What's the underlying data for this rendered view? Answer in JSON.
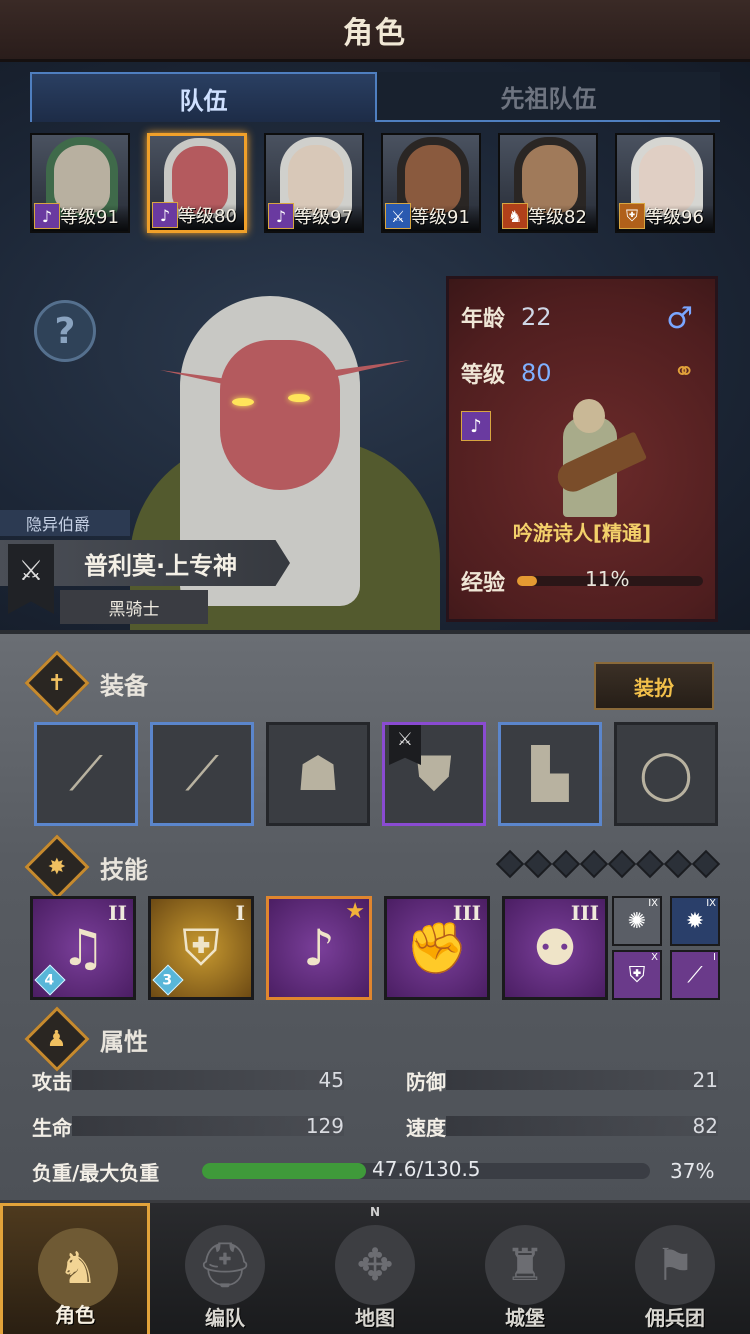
{
  "header": {
    "title": "角色"
  },
  "tabs": [
    {
      "label": "队伍",
      "active": true
    },
    {
      "label": "先祖队伍",
      "active": false
    }
  ],
  "roster": [
    {
      "level": "等级91",
      "skin": "#b8b0a0",
      "hair": "#3f6a4a",
      "class_icon": "lute-icon",
      "class_color": "#6a3aa0",
      "selected": false
    },
    {
      "level": "等级80",
      "skin": "#b45a5e",
      "hair": "#c8c8c4",
      "class_icon": "lute-icon",
      "class_color": "#6a3aa0",
      "selected": true
    },
    {
      "level": "等级97",
      "skin": "#d8c8b8",
      "hair": "#d0d0cc",
      "class_icon": "lute-icon",
      "class_color": "#6a3aa0",
      "selected": false
    },
    {
      "level": "等级91",
      "skin": "#8a5a3e",
      "hair": "#2a2624",
      "class_icon": "sword-icon",
      "class_color": "#2a5ab0",
      "selected": false
    },
    {
      "level": "等级82",
      "skin": "#a07a5a",
      "hair": "#2a2624",
      "class_icon": "horse-icon",
      "class_color": "#b0401a",
      "selected": false
    },
    {
      "level": "等级96",
      "skin": "#e0cfc4",
      "hair": "#d6d6d2",
      "class_icon": "shield-icon",
      "class_color": "#b0601a",
      "selected": false
    }
  ],
  "character": {
    "title": "隐异伯爵",
    "name": "普利莫·上专神",
    "class": "黑骑士"
  },
  "info": {
    "age_label": "年龄",
    "age": "22",
    "level_label": "等级",
    "level": "80",
    "class_name": "吟游诗人[精通]",
    "exp_label": "经验",
    "exp_percent": 11,
    "exp_text": "11%"
  },
  "equipment": {
    "title": "装备",
    "dress_button": "装扮",
    "slots": [
      {
        "item": "spear-icon",
        "rarity": "blue"
      },
      {
        "item": "spear-icon",
        "rarity": "blue"
      },
      {
        "item": "hood-icon",
        "rarity": "none"
      },
      {
        "item": "armor-icon",
        "rarity": "purple"
      },
      {
        "item": "boots-icon",
        "rarity": "blue"
      },
      {
        "item": "ring-icon",
        "rarity": "none"
      }
    ]
  },
  "skills": {
    "title": "技能",
    "slot_count": 8,
    "main": [
      {
        "rank": "II",
        "badge": "4",
        "theme": "violet",
        "icon": "music-note-icon"
      },
      {
        "rank": "I",
        "badge": "3",
        "theme": "gold",
        "icon": "holy-shield-icon"
      },
      {
        "rank": "",
        "badge": "",
        "theme": "violet",
        "icon": "crystal-note-icon",
        "starred": true
      },
      {
        "rank": "III",
        "badge": "",
        "theme": "violet",
        "icon": "crystal-muscle-icon"
      },
      {
        "rank": "III",
        "badge": "",
        "theme": "violet",
        "icon": "crystal-group-icon"
      }
    ],
    "mini": [
      {
        "rank": "IX",
        "theme": "grey",
        "icon": "burst-icon"
      },
      {
        "rank": "IX",
        "theme": "navy",
        "icon": "shatter-icon"
      },
      {
        "rank": "X",
        "theme": "violet",
        "icon": "shield-icon"
      },
      {
        "rank": "I",
        "theme": "violet",
        "icon": "staff-icon"
      }
    ]
  },
  "attributes": {
    "title": "属性",
    "attack_label": "攻击",
    "attack": "45",
    "defense_label": "防御",
    "defense": "21",
    "hp_label": "生命",
    "hp": "129",
    "speed_label": "速度",
    "speed": "82",
    "load_label": "负重/最大负重",
    "load_text": "47.6/130.5",
    "load_fraction": 0.365,
    "load_percent": "37%"
  },
  "nav": [
    {
      "label": "角色",
      "active": true,
      "icon": "knight-icon"
    },
    {
      "label": "编队",
      "active": false,
      "icon": "helmet-icon"
    },
    {
      "label": "地图",
      "active": false,
      "icon": "compass-icon",
      "compass": "N"
    },
    {
      "label": "城堡",
      "active": false,
      "icon": "castle-icon"
    },
    {
      "label": "佣兵团",
      "active": false,
      "icon": "banner-icon"
    }
  ]
}
